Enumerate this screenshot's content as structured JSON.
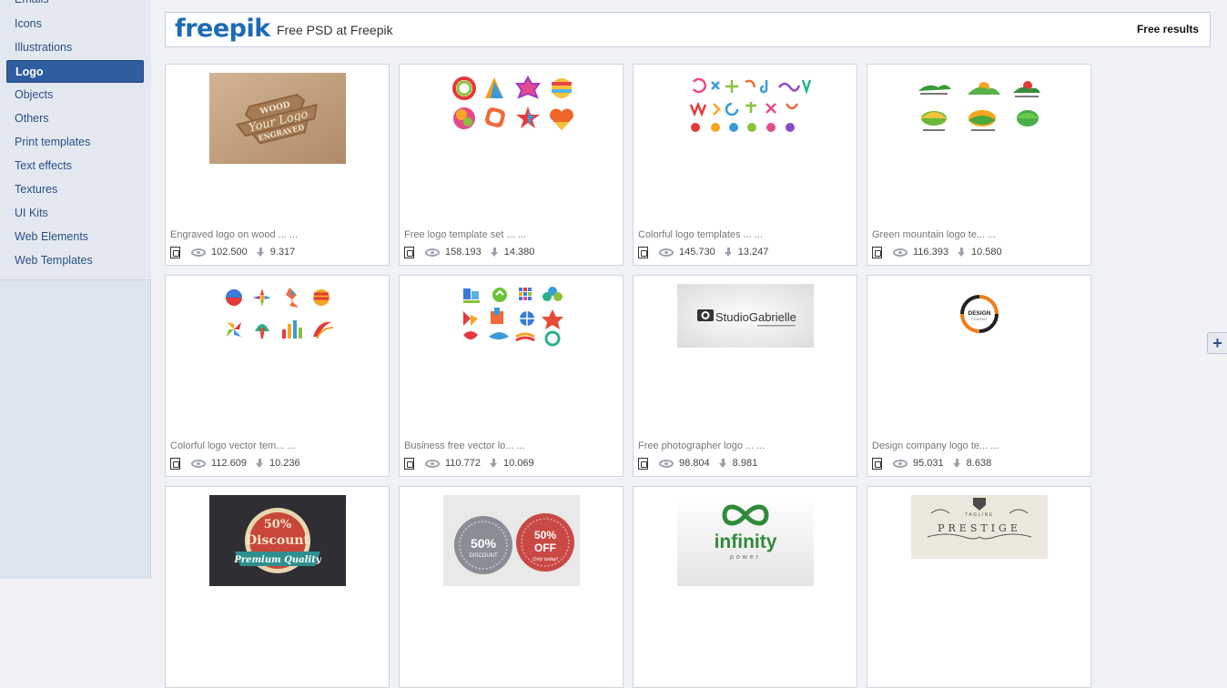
{
  "sidebar": {
    "items": [
      {
        "label": "Emails"
      },
      {
        "label": "Icons"
      },
      {
        "label": "Illustrations"
      },
      {
        "label": "Logo"
      },
      {
        "label": "Objects"
      },
      {
        "label": "Others"
      },
      {
        "label": "Print templates"
      },
      {
        "label": "Text effects"
      },
      {
        "label": "Textures"
      },
      {
        "label": "UI Kits"
      },
      {
        "label": "Web Elements"
      },
      {
        "label": "Web Templates"
      }
    ],
    "active": "Logo"
  },
  "header": {
    "logo": "freepik",
    "title": "Free PSD at Freepik",
    "right_label": "Free results"
  },
  "cards": [
    {
      "title": "Engraved logo on wood ... ...",
      "views": "102.500",
      "downloads": "9.317",
      "thumb": "engraved-wood-logo"
    },
    {
      "title": "Free logo template set ...   ...",
      "views": "158.193",
      "downloads": "14.380",
      "thumb": "logo-template-set"
    },
    {
      "title": "Colorful logo templates ...   ...",
      "views": "145.730",
      "downloads": "13.247",
      "thumb": "colorful-logo-templates"
    },
    {
      "title": "Green mountain logo te...   ...",
      "views": "116.393",
      "downloads": "10.580",
      "thumb": "green-mountain-logos"
    },
    {
      "title": "Colorful logo vector tem...   ...",
      "views": "112.609",
      "downloads": "10.236",
      "thumb": "colorful-logo-vector"
    },
    {
      "title": "Business free vector lo...   ...",
      "views": "110.772",
      "downloads": "10.069",
      "thumb": "business-logos"
    },
    {
      "title": "Free photographer logo ...   ...",
      "views": "98.804",
      "downloads": "8.981",
      "thumb": "photographer-logo"
    },
    {
      "title": "Design company logo te...   ...",
      "views": "95.031",
      "downloads": "8.638",
      "thumb": "design-company-logo"
    },
    {
      "title": "",
      "views": "",
      "downloads": "",
      "thumb": "discount-badge"
    },
    {
      "title": "",
      "views": "",
      "downloads": "",
      "thumb": "sale-badges"
    },
    {
      "title": "",
      "views": "",
      "downloads": "",
      "thumb": "infinity-logo"
    },
    {
      "title": "",
      "views": "",
      "downloads": "",
      "thumb": "prestige-logo"
    }
  ],
  "thumb_text": {
    "engraved": [
      "WOOD",
      "Your Logo",
      "ENGRAVED"
    ],
    "studio": "StudioGabrielle",
    "design": [
      "DESIGN",
      "COMPANY"
    ],
    "discount": [
      "50%",
      "Discount",
      "Premium Quality"
    ],
    "sale": [
      "50%",
      "DISCOUNT",
      "50%",
      "OFF",
      "Only today!"
    ],
    "infinity": [
      "infinity",
      "power"
    ],
    "prestige": [
      "TAGLINE",
      "PRESTIGE"
    ]
  },
  "expand_label": "+"
}
